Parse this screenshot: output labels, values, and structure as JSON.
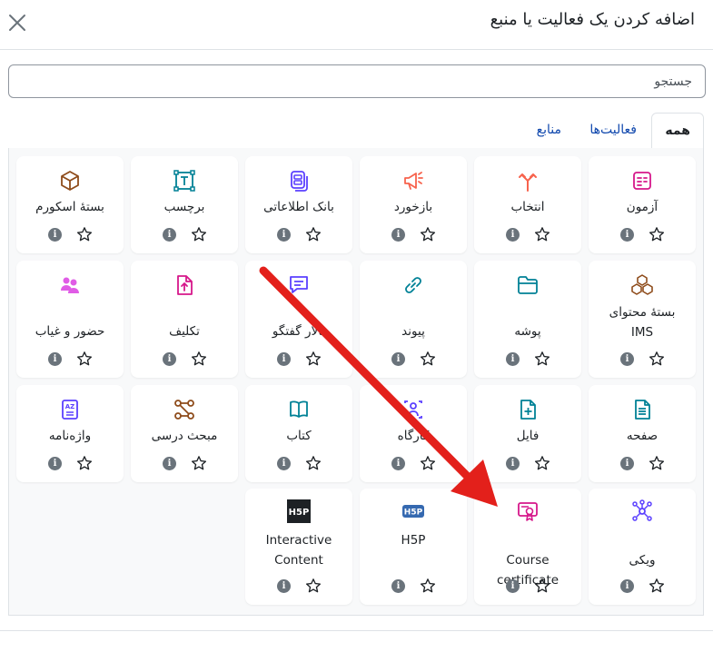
{
  "modal": {
    "title": "اضافه کردن یک فعالیت یا منبع"
  },
  "search": {
    "placeholder": "جستجو"
  },
  "tabs": [
    {
      "label": "همه",
      "active": true
    },
    {
      "label": "فعالیت‌ها",
      "active": false
    },
    {
      "label": "منابع",
      "active": false
    }
  ],
  "modules": [
    {
      "name": "آزمون",
      "icon": "quiz-icon",
      "color": "#d6178a"
    },
    {
      "name": "انتخاب",
      "icon": "choice-icon",
      "color": "#f7634d"
    },
    {
      "name": "بازخورد",
      "icon": "feedback-icon",
      "color": "#f7634d"
    },
    {
      "name": "بانک اطلاعاتی",
      "icon": "database-icon",
      "color": "#5b40ff"
    },
    {
      "name": "برچسب",
      "icon": "label-icon",
      "color": "#008196"
    },
    {
      "name": "بستهٔ اسکورم",
      "icon": "scorm-icon",
      "color": "#8e4b1a"
    },
    {
      "name": "بستهٔ محتوای IMS",
      "icon": "ims-package-icon",
      "color": "#8e4b1a"
    },
    {
      "name": "پوشه",
      "icon": "folder-icon",
      "color": "#008196"
    },
    {
      "name": "پیوند",
      "icon": "link-icon",
      "color": "#008196"
    },
    {
      "name": "تالار گفتگو",
      "icon": "forum-icon",
      "color": "#5b40ff"
    },
    {
      "name": "تکلیف",
      "icon": "assignment-icon",
      "color": "#d6178a"
    },
    {
      "name": "حضور و غیاب",
      "icon": "attendance-icon",
      "color": "#e05ce6"
    },
    {
      "name": "صفحه",
      "icon": "page-icon",
      "color": "#008196"
    },
    {
      "name": "فایل",
      "icon": "file-icon",
      "color": "#008196"
    },
    {
      "name": "کارگاه",
      "icon": "workshop-icon",
      "color": "#5b40ff"
    },
    {
      "name": "کتاب",
      "icon": "book-icon",
      "color": "#008196"
    },
    {
      "name": "مبحث درسی",
      "icon": "subsection-icon",
      "color": "#8e4b1a"
    },
    {
      "name": "واژه‌نامه",
      "icon": "glossary-icon",
      "color": "#5b40ff"
    },
    {
      "name": "ویکی",
      "icon": "wiki-icon",
      "color": "#5b40ff"
    },
    {
      "name": "Course certificate",
      "icon": "certificate-icon",
      "color": "#d6178a"
    },
    {
      "name": "H5P",
      "icon": "h5p-icon",
      "color": "#3569b0"
    },
    {
      "name": "Interactive Content",
      "icon": "h5p-interactive-icon",
      "color": "#1d2125"
    }
  ],
  "info_glyph": "i",
  "colors": {
    "link": "#0f47ad",
    "arrow": "#e3201b",
    "panel_bg": "#f8f9fa"
  }
}
